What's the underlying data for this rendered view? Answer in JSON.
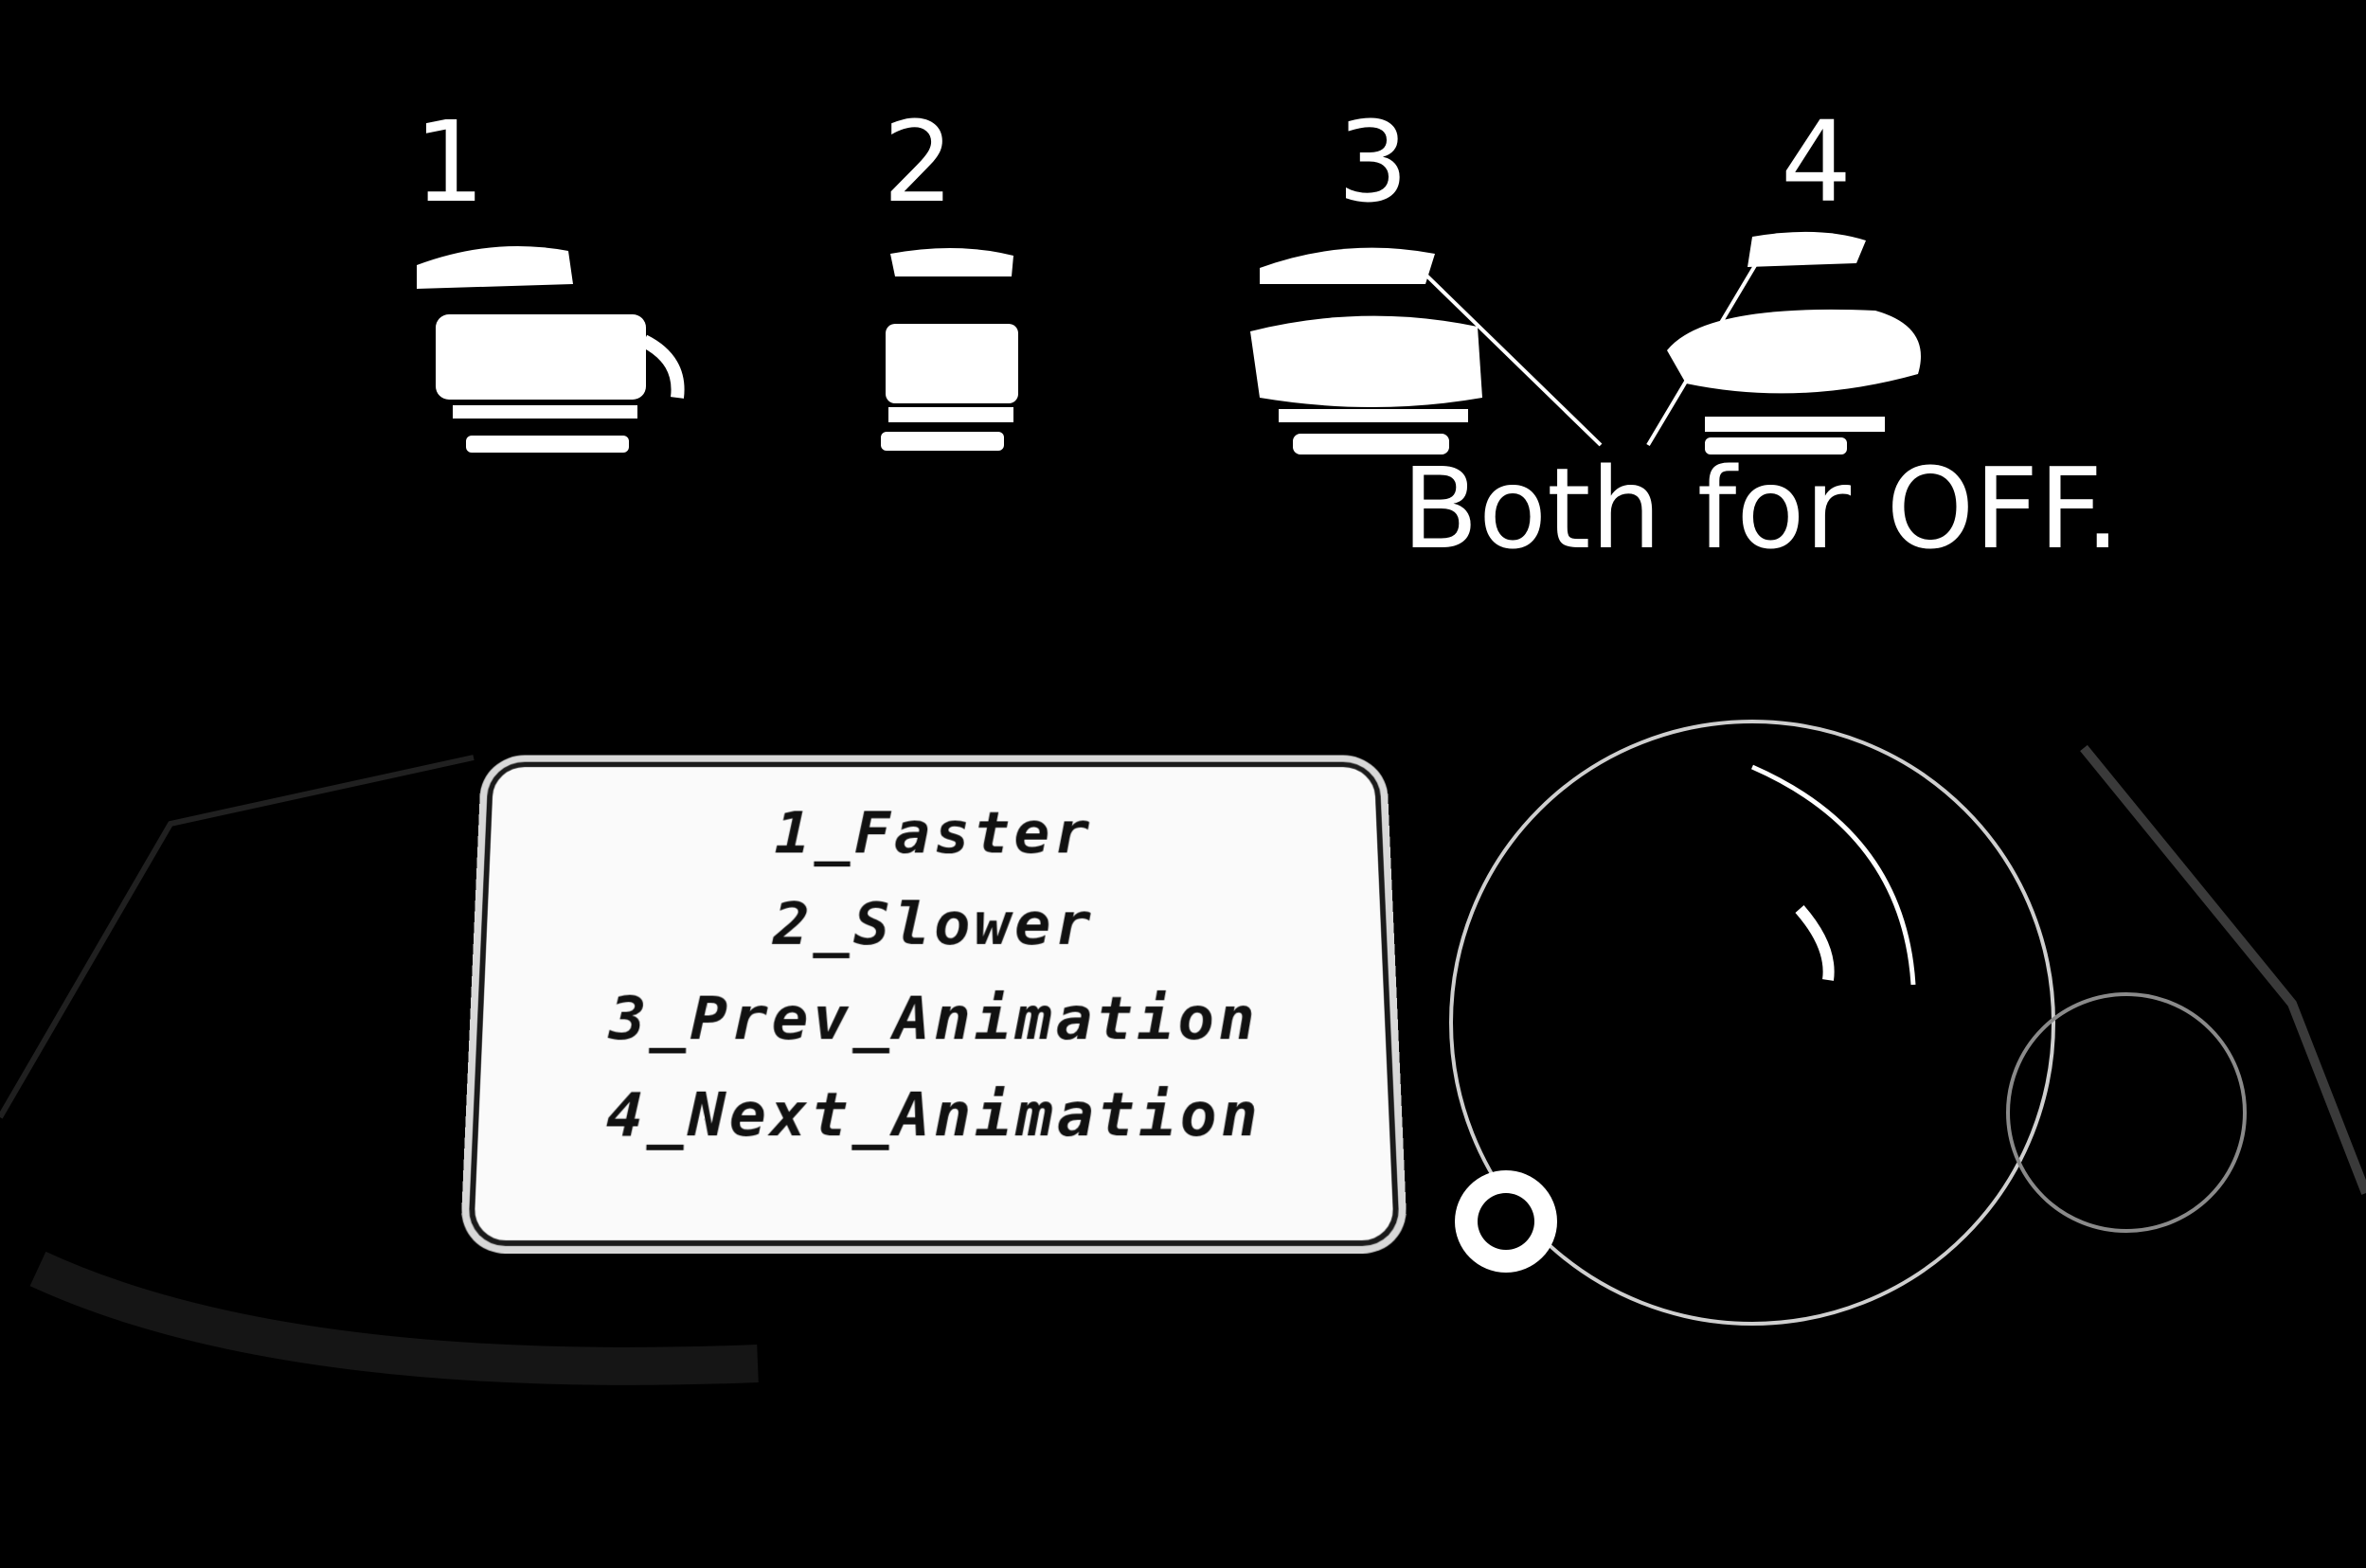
{
  "button_labels": [
    "1",
    "2",
    "3",
    "4"
  ],
  "annotation": "Both for OFF.",
  "display_lines": [
    "1_Faster",
    "2_Slower",
    "3_Prev_Animation",
    "4_Next_Animation"
  ],
  "colors": {
    "background": "#000000",
    "foreground": "#ffffff",
    "lcd_background": "#fafafa",
    "lcd_text": "#111111"
  }
}
